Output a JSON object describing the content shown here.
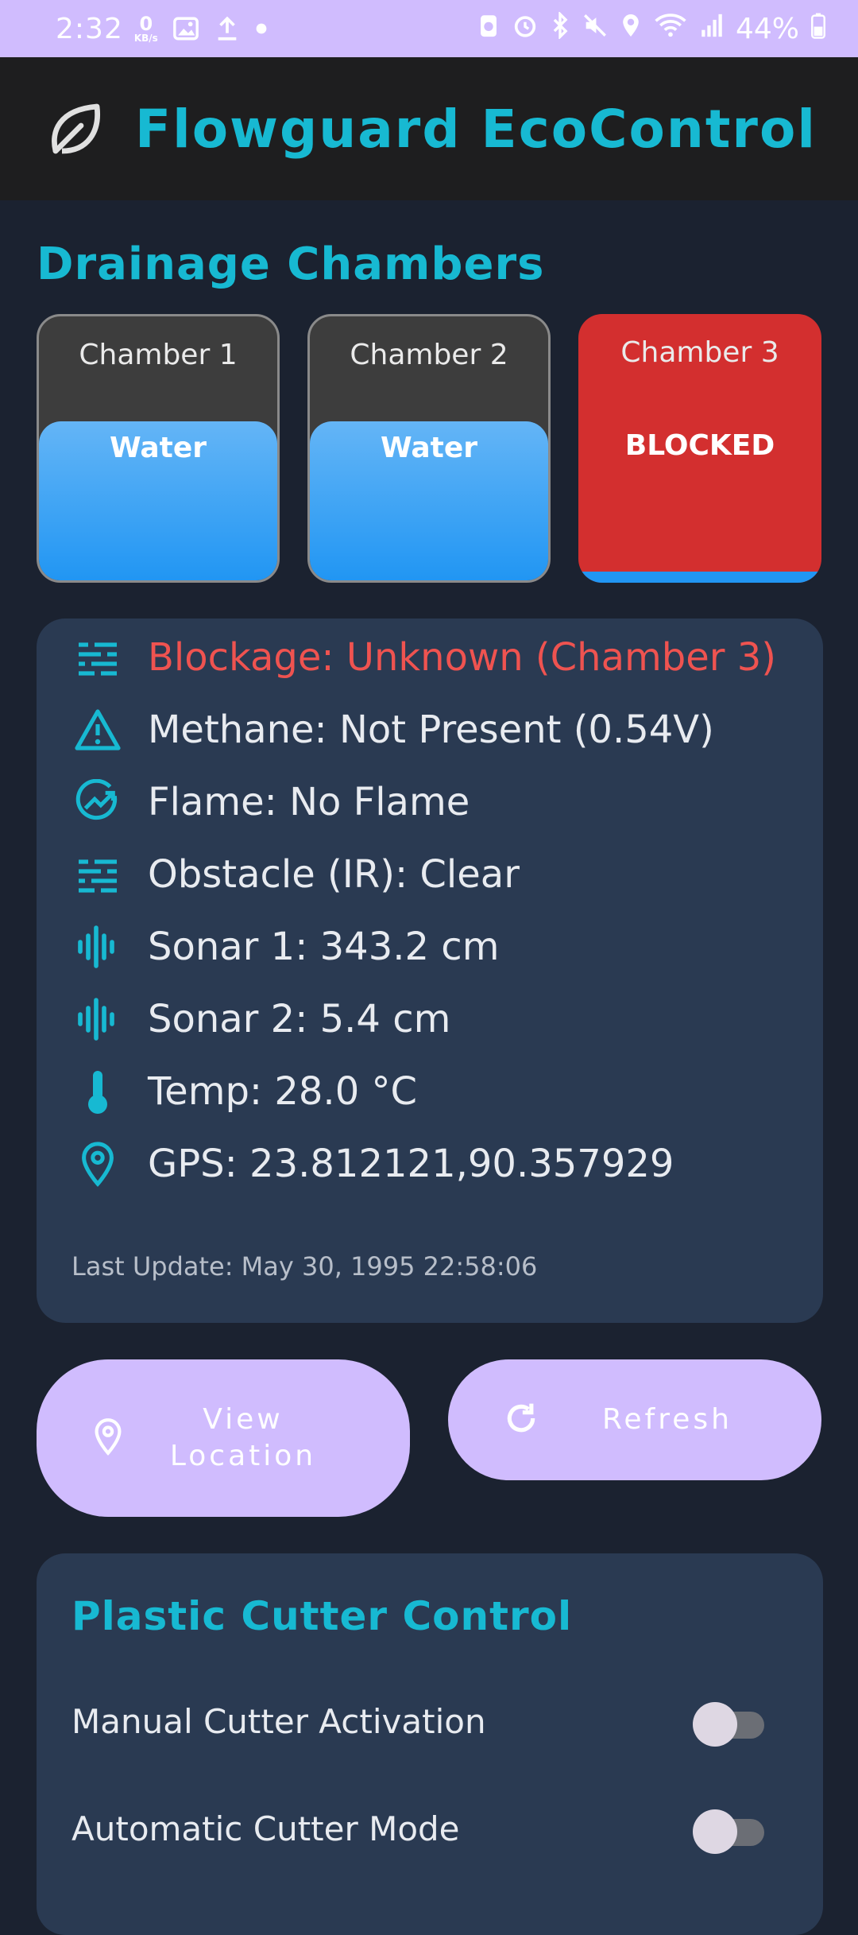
{
  "status_bar": {
    "time": "2:32",
    "net_speed_value": "0",
    "net_speed_unit": "KB/s",
    "battery": "44%"
  },
  "app": {
    "title": "Flowguard EcoControl"
  },
  "chambers": {
    "section_title": "Drainage Chambers",
    "items": [
      {
        "name": "Chamber 1",
        "state": "Water"
      },
      {
        "name": "Chamber 2",
        "state": "Water"
      },
      {
        "name": "Chamber 3",
        "state": "BLOCKED"
      }
    ]
  },
  "status": {
    "blockage": "Blockage: Unknown (Chamber 3)",
    "methane": "Methane: Not Present (0.54V)",
    "flame": "Flame: No Flame",
    "obstacle": "Obstacle (IR): Clear",
    "sonar1": "Sonar 1: 343.2 cm",
    "sonar2": "Sonar 2: 5.4 cm",
    "temp": "Temp: 28.0 °C",
    "gps": "GPS: 23.812121,90.357929",
    "last_update": "Last Update: May 30, 1995 22:58:06"
  },
  "actions": {
    "view_location_line1": "View",
    "view_location_line2": "Location",
    "refresh": "Refresh"
  },
  "cutter": {
    "title": "Plastic Cutter Control",
    "manual_label": "Manual Cutter Activation",
    "manual_on": false,
    "auto_label": "Automatic Cutter Mode",
    "auto_on": false
  },
  "colors": {
    "accent": "#17b9d2",
    "alert": "#ef5350",
    "blocked": "#d32f2f",
    "water": "#2196f3",
    "button": "#d0bcfe"
  }
}
